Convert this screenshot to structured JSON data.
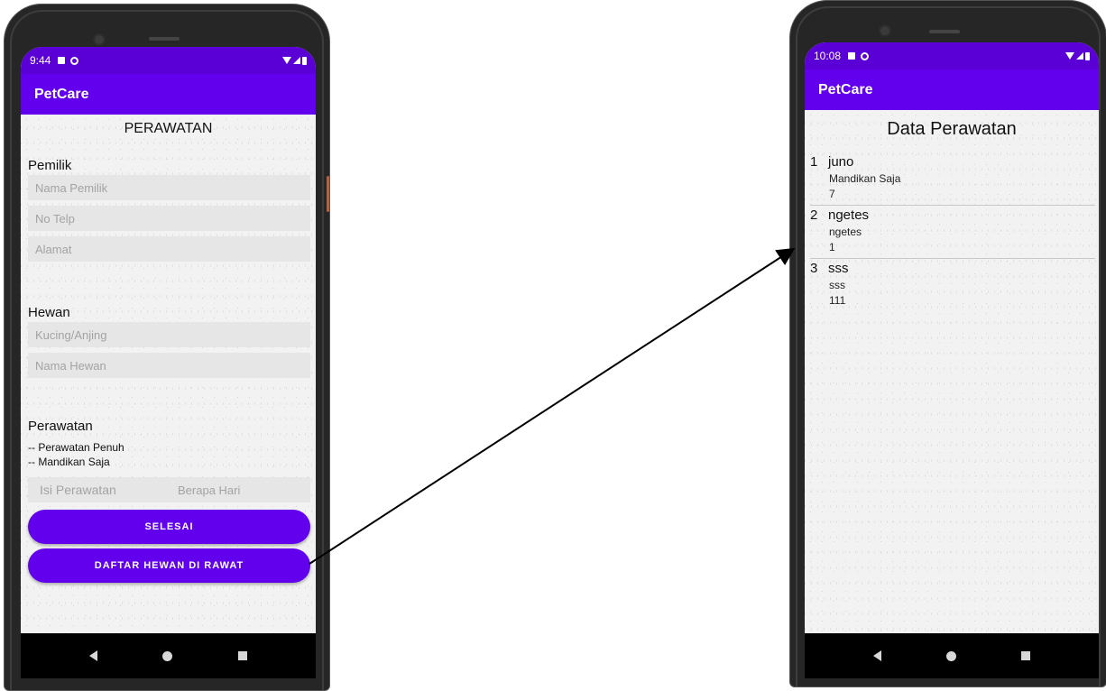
{
  "left_screen": {
    "status_time": "9:44",
    "app_title": "PetCare",
    "form_title": "PERAWATAN",
    "owner_section": "Pemilik",
    "owner_name_placeholder": "Nama Pemilik",
    "phone_placeholder": "No Telp",
    "address_placeholder": "Alamat",
    "animal_section": "Hewan",
    "animal_type_placeholder": "Kucing/Anjing",
    "animal_name_placeholder": "Nama Hewan",
    "care_section": "Perawatan",
    "care_option_1": "-- Perawatan Penuh",
    "care_option_2": "-- Mandikan Saja",
    "care_input_placeholder": "Isi Perawatan",
    "days_placeholder": "Berapa Hari",
    "finish_button": "SELESAI",
    "list_button": "DAFTAR HEWAN DI RAWAT"
  },
  "right_screen": {
    "status_time": "10:08",
    "app_title": "PetCare",
    "list_title": "Data Perawatan",
    "items": [
      {
        "num": "1",
        "name": "juno",
        "care": "Mandikan Saja",
        "days": "7"
      },
      {
        "num": "2",
        "name": "ngetes",
        "care": "ngetes",
        "days": "1"
      },
      {
        "num": "3",
        "name": "sss",
        "care": "sss",
        "days": "111"
      }
    ]
  },
  "colors": {
    "app_bar": "#6200ee",
    "status_bar": "#5a00d6",
    "button": "#6200ee"
  },
  "icons": {
    "nav": [
      "nav-back-icon",
      "nav-home-icon",
      "nav-recents-icon"
    ],
    "status": [
      "sim-icon",
      "sync-icon",
      "wifi-icon",
      "signal-icon",
      "battery-icon"
    ]
  }
}
